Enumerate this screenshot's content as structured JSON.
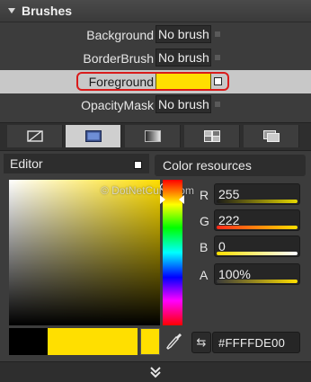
{
  "header": {
    "title": "Brushes"
  },
  "brush_properties": [
    {
      "label": "Background",
      "value": "No brush"
    },
    {
      "label": "BorderBrush",
      "value": "No brush"
    },
    {
      "label": "Foreground",
      "value": "",
      "swatch_color": "#FFDF00",
      "selected": true
    },
    {
      "label": "OpacityMask",
      "value": "No brush"
    }
  ],
  "brush_tabs": [
    "no-brush-icon",
    "solid-brush-icon",
    "gradient-brush-icon",
    "tile-brush-icon",
    "brush-resources-icon"
  ],
  "editor": {
    "title": "Editor"
  },
  "color_resources": {
    "title": "Color resources"
  },
  "watermark": "© DotNetCurry.com",
  "channels": [
    {
      "label": "R",
      "value": "255",
      "bar": "#e6d800"
    },
    {
      "label": "G",
      "value": "222",
      "bar": "#ff3b1f"
    },
    {
      "label": "B",
      "value": "0",
      "bar": "#f3f3f3"
    },
    {
      "label": "A",
      "value": "100%",
      "bar": "#ffdf00"
    }
  ],
  "hex": {
    "button": "⇆",
    "value": "#FFFFDE00"
  },
  "colors": {
    "selected": "#FFDF00",
    "highlight": "#D91B1B"
  }
}
